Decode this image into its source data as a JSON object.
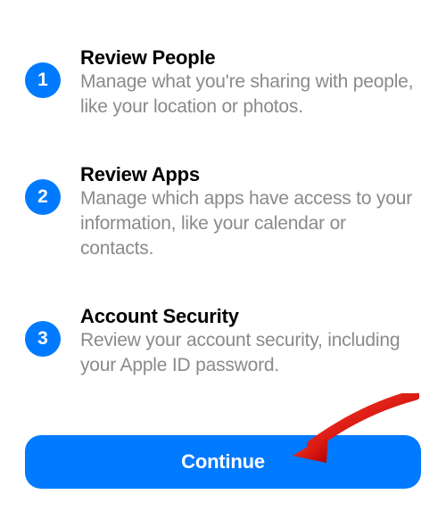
{
  "steps": [
    {
      "number": "1",
      "title": "Review People",
      "description": "Manage what you're sharing with people, like your location or photos."
    },
    {
      "number": "2",
      "title": "Review Apps",
      "description": "Manage which apps have access to your information, like your calendar or contacts."
    },
    {
      "number": "3",
      "title": "Account Security",
      "description": "Review your account security, including your Apple ID password."
    }
  ],
  "continue_label": "Continue"
}
